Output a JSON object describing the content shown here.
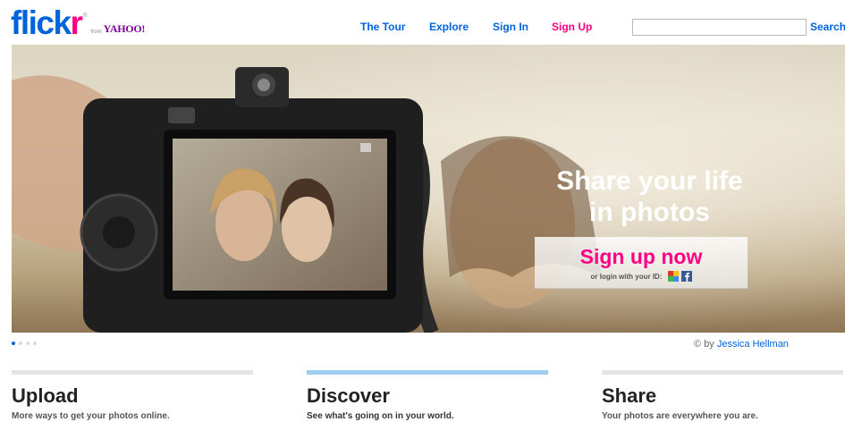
{
  "logo": {
    "word_part1": "flick",
    "word_part2": "r",
    "registered": "®",
    "from": "from",
    "yahoo": "YAHOO!"
  },
  "nav": {
    "tour": "The Tour",
    "explore": "Explore",
    "signin": "Sign In",
    "signup": "Sign Up"
  },
  "search": {
    "value": "",
    "button": "Search"
  },
  "hero": {
    "line1": "Share your life",
    "line2": "in photos",
    "cta": "Sign up now",
    "login_text": "or login with your ID:",
    "login_providers": [
      "google-icon",
      "facebook-icon"
    ]
  },
  "slideshow": {
    "slides": 4,
    "active": 1
  },
  "credit": {
    "prefix": "© by",
    "author": "Jessica Hellman"
  },
  "columns": [
    {
      "title": "Upload",
      "desc": "More ways to get your photos online."
    },
    {
      "title": "Discover",
      "desc": "See what's going on in your world."
    },
    {
      "title": "Share",
      "desc": "Your photos are everywhere you are."
    }
  ],
  "colors": {
    "brand_blue": "#0063dc",
    "brand_pink": "#ff0084",
    "active_bar": "#9dcdf0"
  }
}
